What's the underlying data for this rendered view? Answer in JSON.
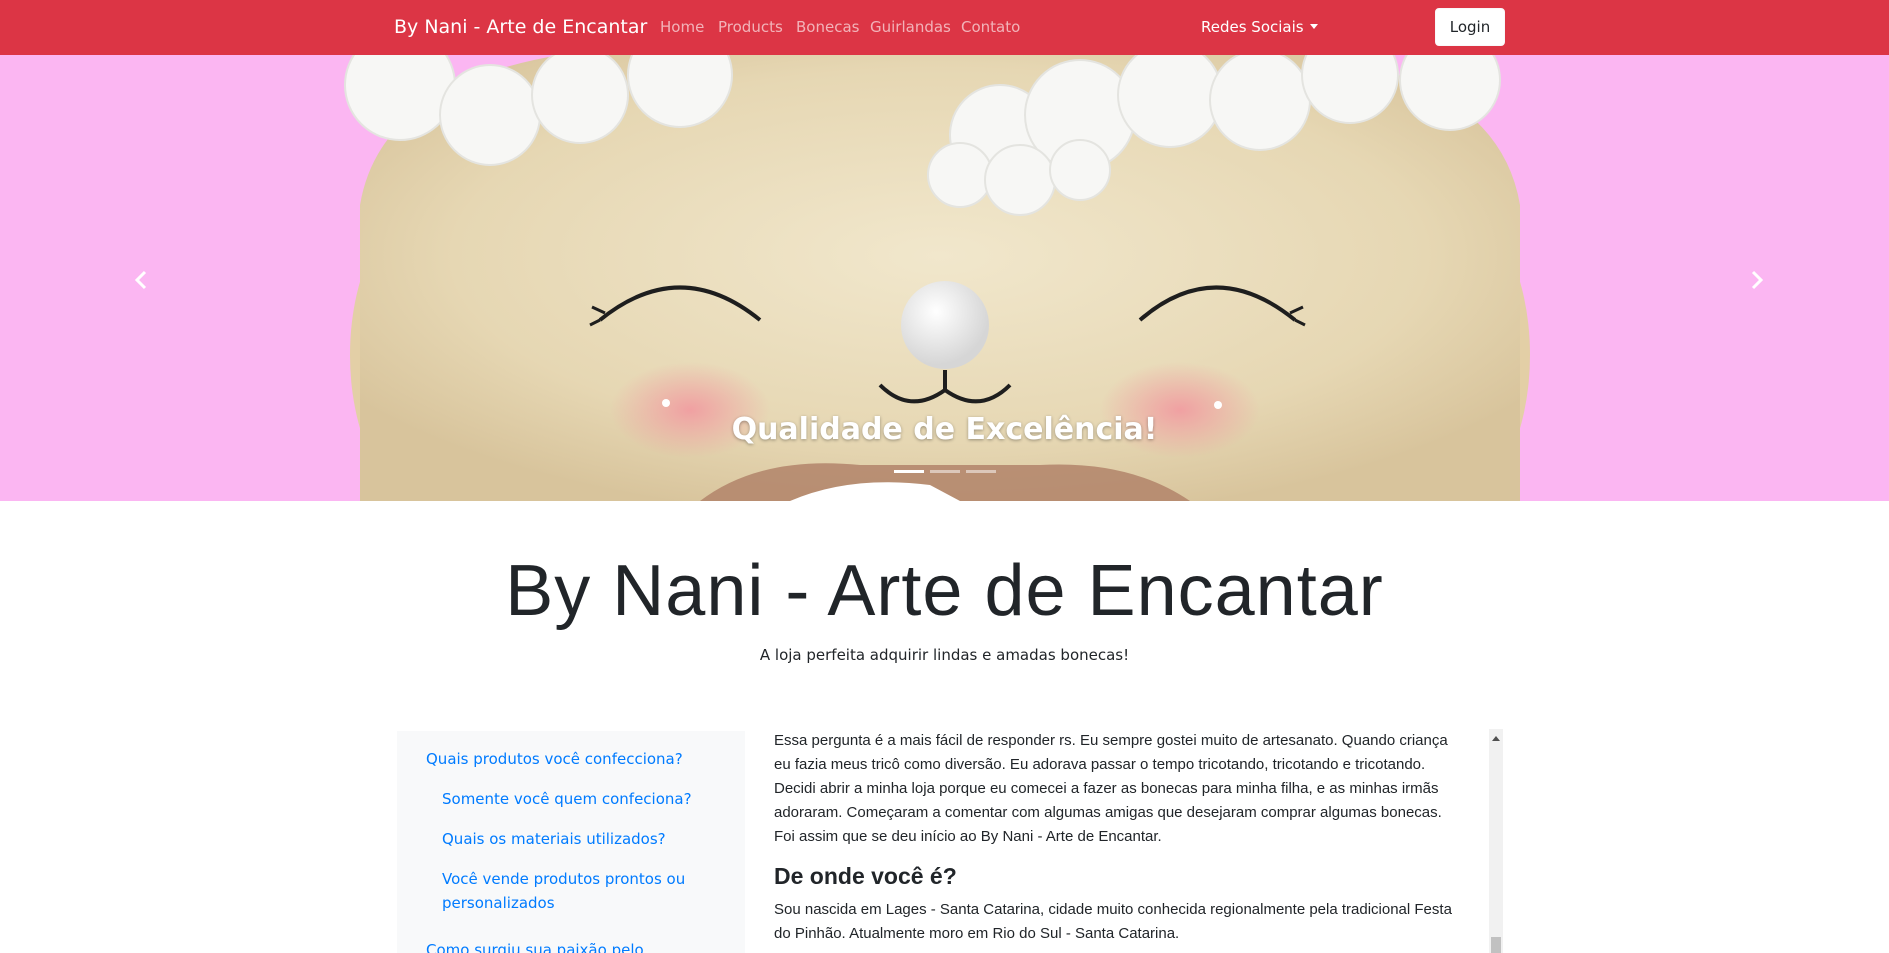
{
  "navbar": {
    "brand": "By Nani - Arte de Encantar",
    "links": [
      "Home",
      "Products",
      "Bonecas",
      "Guirlandas",
      "Contato"
    ],
    "dropdown_label": "Redes Sociais",
    "login_label": "Login",
    "background_color": "#dc3545"
  },
  "carousel": {
    "caption": "Qualidade de Excelência!",
    "indicator_count": 3,
    "active_index": 0,
    "background_color": "#fbb6f2",
    "prev_icon": "chevron-left-icon",
    "next_icon": "chevron-right-icon"
  },
  "hero": {
    "title": "By Nani - Arte de Encantar",
    "lead": "A loja perfeita adquirir lindas e amadas bonecas!"
  },
  "sidebar": {
    "items": [
      "Quais produtos você confecciona?",
      "Somente você quem confeciona?",
      "Quais os materiais utilizados?",
      "Você vende produtos prontos ou",
      "personalizados",
      "Como surgiu sua paixão pelo"
    ]
  },
  "content": {
    "paragraph1": [
      "Essa pergunta é a mais fácil de responder rs. Eu sempre gostei muito de artesanato. Quando criança",
      "eu fazia meus tricô como diversão. Eu adorava passar o tempo tricotando, tricotando e tricotando.",
      "Decidi abrir a minha loja porque eu comecei a fazer as bonecas para minha filha, e as minhas irmãs",
      "adoraram. Começaram a comentar com algumas amigas que desejaram comprar algumas bonecas.",
      "Foi assim que se deu início ao By Nani - Arte de Encantar."
    ],
    "heading2": "De onde você é?",
    "paragraph2": [
      "Sou nascida em Lages - Santa Catarina, cidade muito conhecida regionalmente pela tradicional Festa",
      "do Pinhão. Atualmente moro em Rio do Sul - Santa Catarina."
    ]
  }
}
